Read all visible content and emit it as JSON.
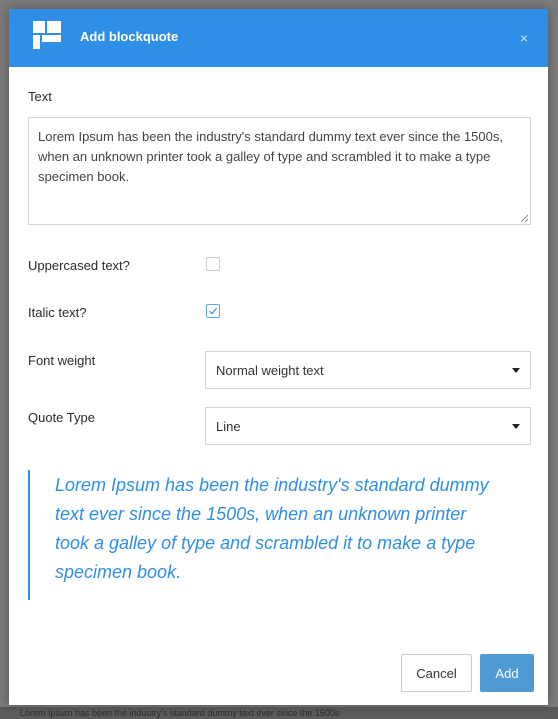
{
  "modal": {
    "title": "Add blockquote",
    "close_label": "×"
  },
  "form": {
    "text_label": "Text",
    "text_value": "Lorem Ipsum has been the industry's standard dummy text ever since the 1500s, when an unknown printer took a galley of type and scrambled it to make a type specimen book.",
    "uppercase_label": "Uppercased text?",
    "uppercase_checked": false,
    "italic_label": "Italic text?",
    "italic_checked": true,
    "font_weight_label": "Font weight",
    "font_weight_value": "Normal weight text",
    "quote_type_label": "Quote Type",
    "quote_type_value": "Line"
  },
  "preview": {
    "text": "Lorem Ipsum has been the industry's standard dummy text ever since the 1500s, when an unknown printer took a galley of type and scrambled it to make a type specimen book."
  },
  "buttons": {
    "cancel_label": "Cancel",
    "add_label": "Add"
  },
  "background": {
    "footer_text": "Lorem Ipsum has been the industry's standard dummy text ever since the 1500s"
  },
  "icons": {
    "logo": "blocks-logo-icon",
    "close": "close-icon",
    "check": "check-icon",
    "caret": "caret-down-icon",
    "resize": "resize-grip-icon"
  },
  "colors": {
    "header": "#2f8fe6",
    "accent": "#2f8fe6",
    "add_button": "#4f9ad3"
  }
}
